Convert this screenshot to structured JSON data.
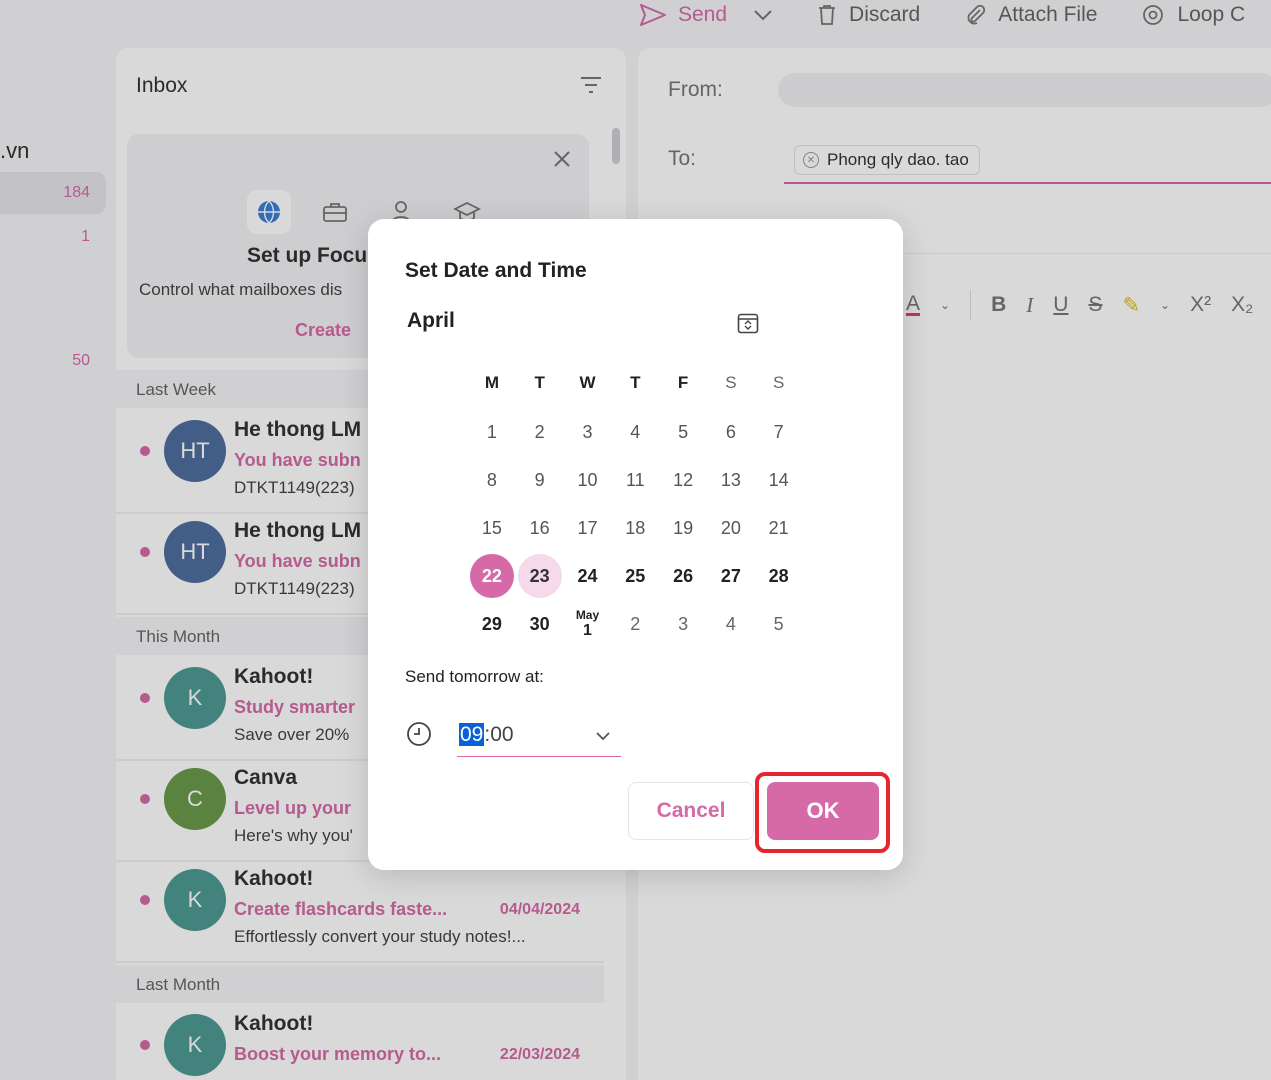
{
  "toolbar": {
    "send": "Send",
    "discard": "Discard",
    "attach": "Attach File",
    "loop": "Loop C"
  },
  "folders": {
    "account": ".vn",
    "counts": [
      "184",
      "1",
      "50"
    ]
  },
  "inbox": {
    "title": "Inbox",
    "focus_card": {
      "title": "Set up Focu",
      "description": "Control what mailboxes dis",
      "create": "Create"
    },
    "groups": [
      "Last Week",
      "This Month",
      "Last Month"
    ],
    "messages": [
      {
        "initials": "HT",
        "sender": "He thong LM",
        "subject": "You have subn",
        "date": "",
        "preview": "DTKT1149(223)"
      },
      {
        "initials": "HT",
        "sender": "He thong LM",
        "subject": "You have subn",
        "date": "",
        "preview": "DTKT1149(223)"
      },
      {
        "initials": "K",
        "sender": "Kahoot!",
        "subject": "Study smarter",
        "date": "",
        "preview": "Save over 20%"
      },
      {
        "initials": "C",
        "sender": "Canva",
        "subject": "Level up your",
        "date": "",
        "preview": "Here's why you'"
      },
      {
        "initials": "K",
        "sender": "Kahoot!",
        "subject": "Create flashcards faste...",
        "date": "04/04/2024",
        "preview": "Effortlessly convert your study notes!..."
      },
      {
        "initials": "K",
        "sender": "Kahoot!",
        "subject": "Boost your memory to...",
        "date": "22/03/2024",
        "preview": ""
      }
    ]
  },
  "compose": {
    "from_label": "From:",
    "to_label": "To:",
    "recipient": "Phong qly dao. tao"
  },
  "dialog": {
    "title": "Set Date and Time",
    "month": "April",
    "weekdays": [
      "M",
      "T",
      "W",
      "T",
      "F",
      "S",
      "S"
    ],
    "weeks": [
      [
        "1",
        "2",
        "3",
        "4",
        "5",
        "6",
        "7"
      ],
      [
        "8",
        "9",
        "10",
        "11",
        "12",
        "13",
        "14"
      ],
      [
        "15",
        "16",
        "17",
        "18",
        "19",
        "20",
        "21"
      ],
      [
        "22",
        "23",
        "24",
        "25",
        "26",
        "27",
        "28"
      ],
      [
        "29",
        "30",
        "1",
        "2",
        "3",
        "4",
        "5"
      ]
    ],
    "next_month_label": "May",
    "selected_day": "22",
    "today_day": "23",
    "send_label": "Send tomorrow at:",
    "time_hour": "09",
    "time_rest": ":00",
    "cancel": "Cancel",
    "ok": "OK"
  },
  "colors": {
    "accent": "#d66aa8",
    "today_bg": "#f6d9ea",
    "highlight": "#e6262e",
    "avatar_ht": "#4f6f9e",
    "avatar_kahoot": "#4f9a95",
    "avatar_canva": "#6a9a4a"
  },
  "icons": [
    "send-icon",
    "chevron-down-icon",
    "trash-icon",
    "paperclip-icon",
    "loop-icon",
    "filter-icon",
    "close-icon",
    "globe-icon",
    "briefcase-icon",
    "person-icon",
    "graduation-cap-icon",
    "calendar-icon",
    "clock-icon"
  ]
}
